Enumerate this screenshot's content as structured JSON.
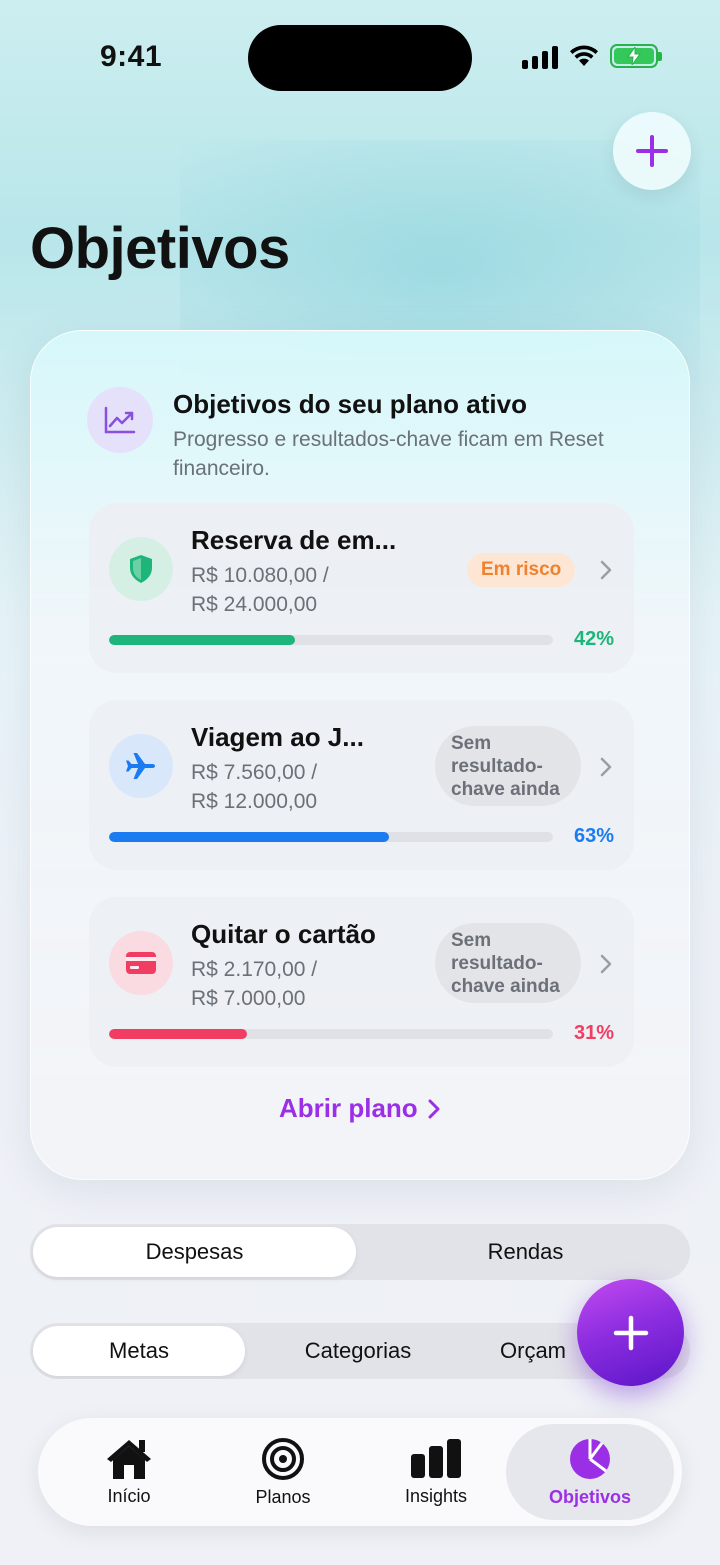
{
  "status_bar": {
    "time": "9:41"
  },
  "header": {
    "title": "Objetivos"
  },
  "plan_card": {
    "title": "Objetivos do seu plano ativo",
    "subtitle": "Progresso e resultados-chave ficam em Reset financeiro.",
    "goals": [
      {
        "name": "Reserva de em...",
        "amount_line1": "R$ 10.080,00 /",
        "amount_line2": "R$ 24.000,00",
        "badge": "Em risco",
        "progress": 0.42,
        "percent_label": "42%",
        "color": "#1db57a",
        "icon": "shield-icon"
      },
      {
        "name": "Viagem ao J...",
        "amount_line1": "R$ 7.560,00 /",
        "amount_line2": "R$ 12.000,00",
        "badge": "Sem resultado-chave ainda",
        "badge_lines": [
          "Sem",
          "resultado-",
          "chave ainda"
        ],
        "progress": 0.63,
        "percent_label": "63%",
        "color": "#1a7cf0",
        "icon": "airplane-icon"
      },
      {
        "name": "Quitar o cartão",
        "amount_line1": "R$ 2.170,00 /",
        "amount_line2": "R$ 7.000,00",
        "badge": "Sem resultado-chave ainda",
        "badge_lines": [
          "Sem",
          "resultado-",
          "chave ainda"
        ],
        "progress": 0.31,
        "percent_label": "31%",
        "color": "#f23d63",
        "icon": "credit-card-icon"
      }
    ],
    "open_plan_label": "Abrir plano"
  },
  "type_segment": {
    "items": [
      "Despesas",
      "Rendas"
    ],
    "selected": "Despesas"
  },
  "view_segment": {
    "items": [
      "Metas",
      "Categorias",
      "Orçam"
    ],
    "selected": "Metas"
  },
  "tab_bar": {
    "items": [
      {
        "label": "Início",
        "icon": "home-icon"
      },
      {
        "label": "Planos",
        "icon": "target-icon"
      },
      {
        "label": "Insights",
        "icon": "bar-chart-icon"
      },
      {
        "label": "Objetivos",
        "icon": "pie-chart-icon"
      }
    ],
    "selected": "Objetivos"
  },
  "colors": {
    "accent": "#9b2fe6",
    "risk": "#f0812d"
  }
}
